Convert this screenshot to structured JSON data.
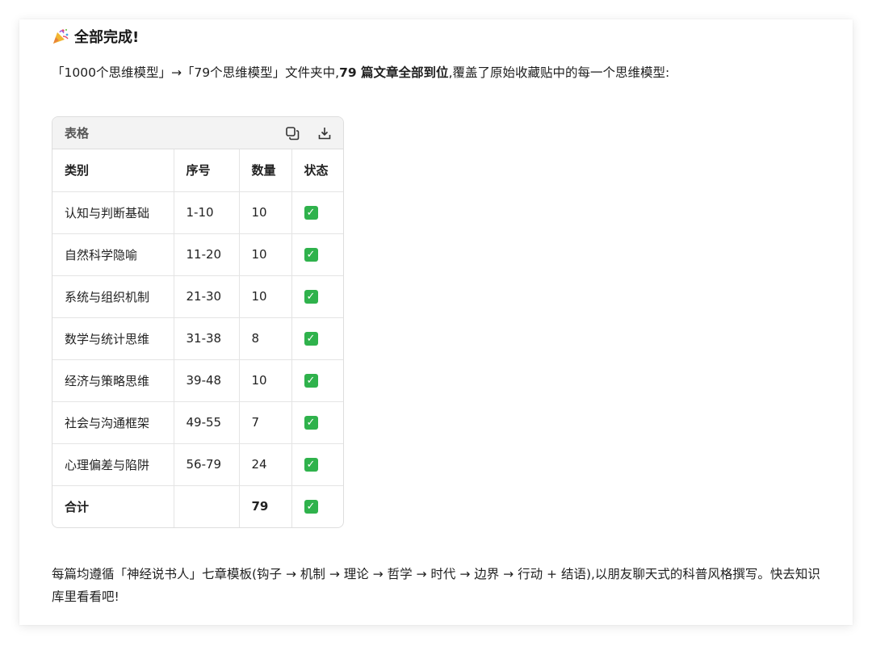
{
  "heading": {
    "icon": "party-popper-icon",
    "title": "全部完成!"
  },
  "intro": {
    "part1": "「1000个思维模型」→「79个思维模型」文件夹中,",
    "bold": "79 篇文章全部到位",
    "part2": ",覆盖了原始收藏贴中的每一个思维模型:"
  },
  "table": {
    "title": "表格",
    "copy_icon": "copy-icon",
    "download_icon": "download-icon",
    "columns": [
      "类别",
      "序号",
      "数量",
      "状态"
    ],
    "rows": [
      {
        "category": "认知与判断基础",
        "range": "1-10",
        "count": "10",
        "status": "✓"
      },
      {
        "category": "自然科学隐喻",
        "range": "11-20",
        "count": "10",
        "status": "✓"
      },
      {
        "category": "系统与组织机制",
        "range": "21-30",
        "count": "10",
        "status": "✓"
      },
      {
        "category": "数学与统计思维",
        "range": "31-38",
        "count": "8",
        "status": "✓"
      },
      {
        "category": "经济与策略思维",
        "range": "39-48",
        "count": "10",
        "status": "✓"
      },
      {
        "category": "社会与沟通框架",
        "range": "49-55",
        "count": "7",
        "status": "✓"
      },
      {
        "category": "心理偏差与陷阱",
        "range": "56-79",
        "count": "24",
        "status": "✓"
      }
    ],
    "total": {
      "category": "合计",
      "range": "",
      "count": "79",
      "status": "✓"
    }
  },
  "outro": {
    "text": "每篇均遵循「神经说书人」七章模板(钩子 → 机制 → 理论 → 哲学 → 时代 → 边界 → 行动 + 结语),以朋友聊天式的科普风格撰写。快去知识库里看看吧!"
  },
  "colors": {
    "check_green": "#2fb24c",
    "table_header_bg": "#f3f3f3",
    "border": "#dedede"
  }
}
